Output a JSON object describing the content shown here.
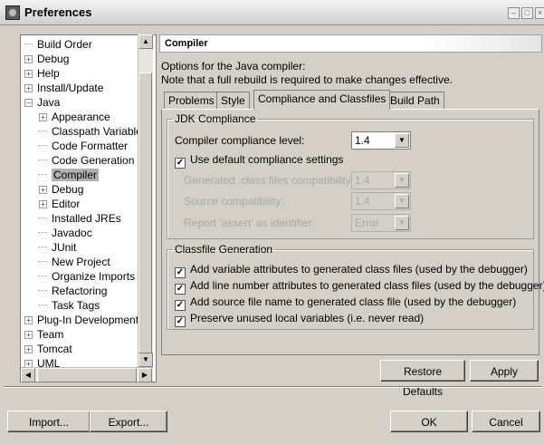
{
  "window": {
    "title": "Preferences",
    "controls": [
      "minimize",
      "maximize",
      "close"
    ]
  },
  "tree": {
    "items": [
      {
        "label": "Build Order",
        "depth": 1,
        "expander": "none"
      },
      {
        "label": "Debug",
        "depth": 0,
        "expander": "+"
      },
      {
        "label": "Help",
        "depth": 0,
        "expander": "+"
      },
      {
        "label": "Install/Update",
        "depth": 0,
        "expander": "+"
      },
      {
        "label": "Java",
        "depth": 0,
        "expander": "-"
      },
      {
        "label": "Appearance",
        "depth": 1,
        "expander": "+"
      },
      {
        "label": "Classpath Variable",
        "depth": 1,
        "expander": "none"
      },
      {
        "label": "Code Formatter",
        "depth": 1,
        "expander": "none"
      },
      {
        "label": "Code Generation",
        "depth": 1,
        "expander": "none"
      },
      {
        "label": "Compiler",
        "depth": 1,
        "expander": "none",
        "selected": true
      },
      {
        "label": "Debug",
        "depth": 1,
        "expander": "+"
      },
      {
        "label": "Editor",
        "depth": 1,
        "expander": "+"
      },
      {
        "label": "Installed JREs",
        "depth": 1,
        "expander": "none"
      },
      {
        "label": "Javadoc",
        "depth": 1,
        "expander": "none"
      },
      {
        "label": "JUnit",
        "depth": 1,
        "expander": "none"
      },
      {
        "label": "New Project",
        "depth": 1,
        "expander": "none"
      },
      {
        "label": "Organize Imports",
        "depth": 1,
        "expander": "none"
      },
      {
        "label": "Refactoring",
        "depth": 1,
        "expander": "none"
      },
      {
        "label": "Task Tags",
        "depth": 1,
        "expander": "none"
      },
      {
        "label": "Plug-In Development",
        "depth": 0,
        "expander": "+"
      },
      {
        "label": "Team",
        "depth": 0,
        "expander": "+"
      },
      {
        "label": "Tomcat",
        "depth": 0,
        "expander": "+"
      },
      {
        "label": "UML",
        "depth": 0,
        "expander": "+"
      }
    ]
  },
  "page": {
    "title": "Compiler",
    "description_line1": "Options for the Java compiler:",
    "description_line2": "Note that a full rebuild is required to make changes effective."
  },
  "tabs": [
    {
      "label": "Problems",
      "active": false
    },
    {
      "label": "Style",
      "active": false
    },
    {
      "label": "Compliance and Classfiles",
      "active": true
    },
    {
      "label": "Build Path",
      "active": false
    }
  ],
  "jdk_compliance": {
    "legend": "JDK Compliance",
    "compliance_level_label": "Compiler compliance level:",
    "compliance_level_value": "1.4",
    "use_defaults_label": "Use default compliance settings",
    "use_defaults_checked": true,
    "generated_label": "Generated .class files compatibility:",
    "generated_value": "1.4",
    "source_label": "Source compatibility:",
    "source_value": "1.4",
    "assert_label": "Report 'assert' as identifier:",
    "assert_value": "Error"
  },
  "classfile_generation": {
    "legend": "Classfile Generation",
    "options": [
      {
        "label": "Add variable attributes to generated class files (used by the debugger)",
        "checked": true
      },
      {
        "label": "Add line number attributes to generated class files (used by the debugger)",
        "checked": true
      },
      {
        "label": "Add source file name to generated class file (used by the debugger)",
        "checked": true
      },
      {
        "label": "Preserve unused local variables (i.e. never read)",
        "checked": true
      }
    ]
  },
  "buttons": {
    "restore_defaults": "Restore Defaults",
    "apply": "Apply",
    "import": "Import...",
    "export": "Export...",
    "ok": "OK",
    "cancel": "Cancel"
  },
  "icons": {
    "checkmark": "✓",
    "dropdown": "▼",
    "scroll_up": "▲",
    "scroll_down": "▼",
    "scroll_left": "◀",
    "scroll_right": "▶"
  }
}
